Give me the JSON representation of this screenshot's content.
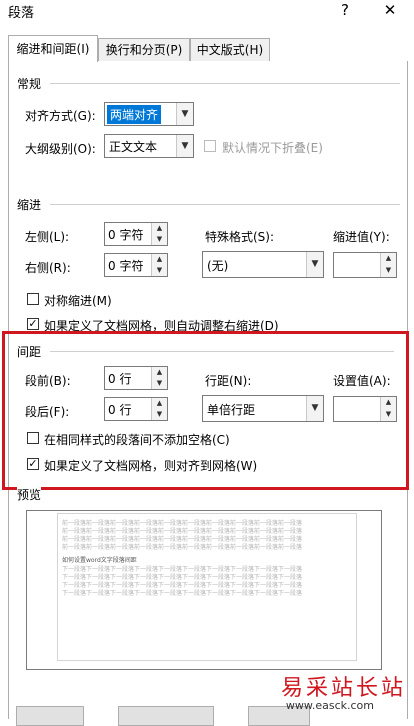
{
  "window": {
    "title": "段落",
    "help_label": "?",
    "close_label": "✕"
  },
  "tabs": [
    {
      "label": "缩进和间距(I)",
      "active": true
    },
    {
      "label": "换行和分页(P)",
      "active": false
    },
    {
      "label": "中文版式(H)",
      "active": false
    }
  ],
  "general": {
    "title": "常规",
    "alignment_label": "对齐方式(G):",
    "alignment_value": "两端对齐",
    "outline_label": "大纲级别(O):",
    "outline_value": "正文文本",
    "collapse_label": "默认情况下折叠(E)"
  },
  "indent": {
    "title": "缩进",
    "left_label": "左侧(L):",
    "left_value": "0 字符",
    "right_label": "右侧(R):",
    "right_value": "0 字符",
    "special_label": "特殊格式(S):",
    "special_value": "(无)",
    "by_label": "缩进值(Y):",
    "by_value": "",
    "mirror_label": "对称缩进(M)",
    "auto_adjust_label": "如果定义了文档网格，则自动调整右缩进(D)"
  },
  "spacing": {
    "title": "间距",
    "before_label": "段前(B):",
    "before_value": "0 行",
    "after_label": "段后(F):",
    "after_value": "0 行",
    "line_label": "行距(N):",
    "line_value": "单倍行距",
    "at_label": "设置值(A):",
    "at_value": "",
    "no_space_label": "在相同样式的段落间不添加空格(C)",
    "snap_grid_label": "如果定义了文档网格，则对齐到网格(W)"
  },
  "preview": {
    "title": "预览",
    "prev_text": "前一段落前一段落前一段落前一段落前一段落前一段落前一段落前一段落前一段落前一段落",
    "sample_text": "如何设置word文字段落间距",
    "next_text": "下一段落下一段落下一段落下一段落下一段落下一段落下一段落下一段落下一段落下一段落"
  },
  "watermark": {
    "text": "易采站长站",
    "url": "www.easck.com"
  },
  "colors": {
    "highlight_box": "#d0171f",
    "selection": "#0078d7"
  }
}
